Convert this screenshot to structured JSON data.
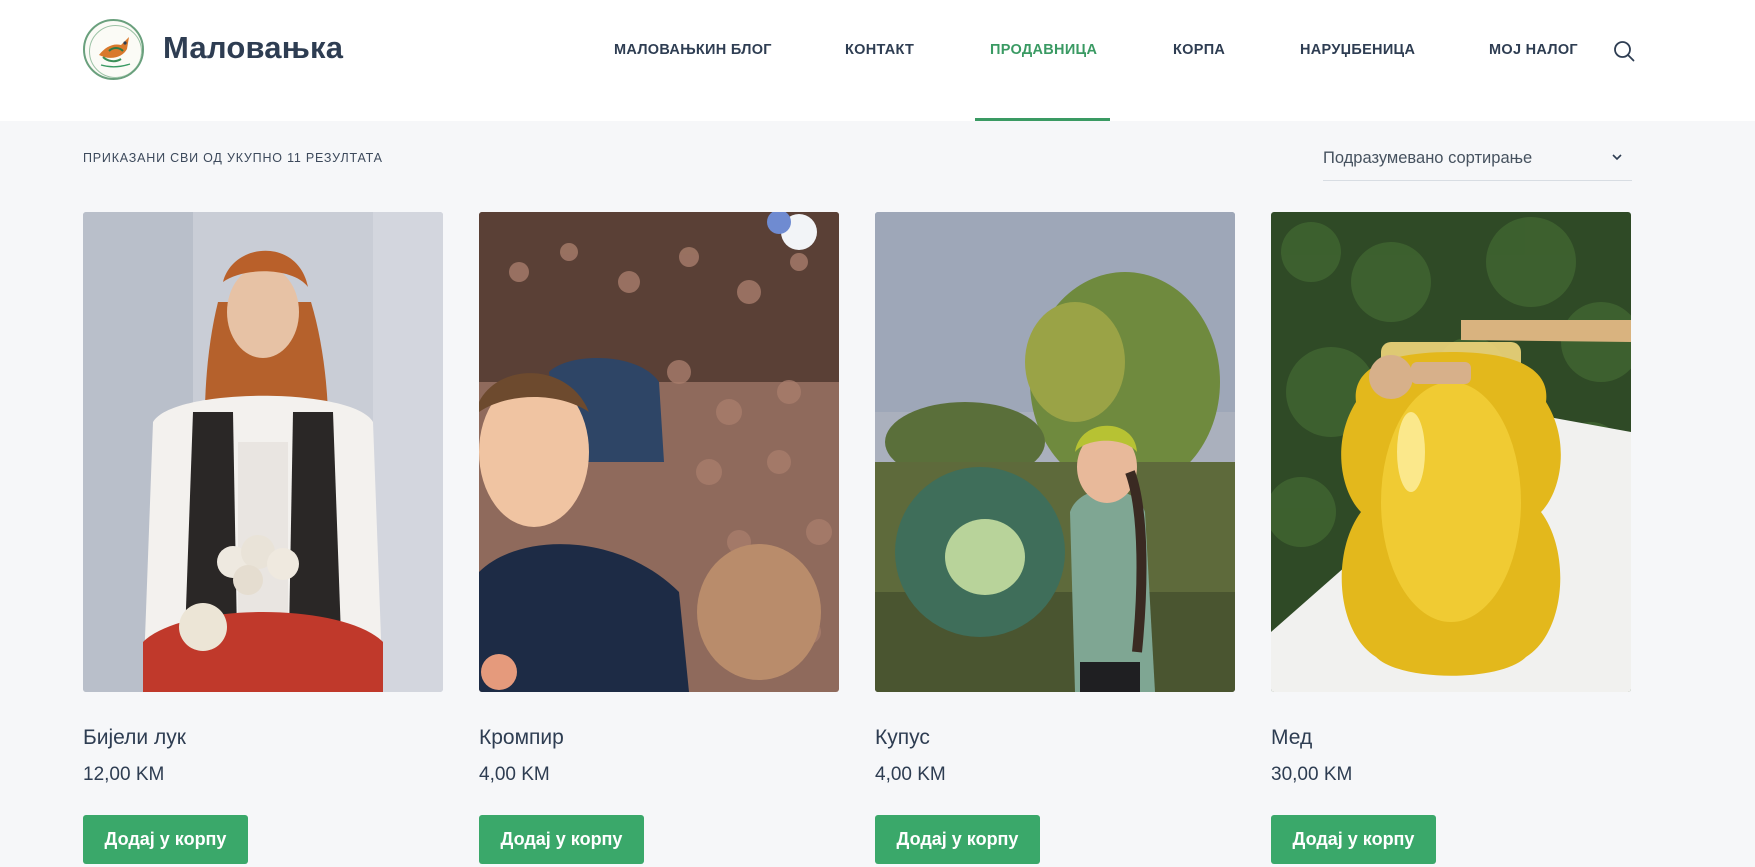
{
  "brand": {
    "name": "Маловањка",
    "logo_icon": "bird-logo-icon"
  },
  "nav": {
    "items": [
      {
        "label": "МАЛОВАЊКИН БЛОГ",
        "active": false
      },
      {
        "label": "КОНТАКТ",
        "active": false
      },
      {
        "label": "ПРОДАВНИЦА",
        "active": true
      },
      {
        "label": "КОРПА",
        "active": false
      },
      {
        "label": "НАРУЏБЕНИЦА",
        "active": false
      },
      {
        "label": "МОЈ НАЛОГ",
        "active": false
      }
    ],
    "search_icon": "search-icon"
  },
  "shop": {
    "result_count": "ПРИКАЗАНИ СВИ ОД УКУПНО 11 РЕЗУЛТАТА",
    "sort_label": "Подразумевано сортирање"
  },
  "products": [
    {
      "title": "Бијели лук",
      "price": "12,00 KM",
      "button": "Додај у корпу"
    },
    {
      "title": "Кромпир",
      "price": "4,00 KM",
      "button": "Додај у корпу"
    },
    {
      "title": "Купус",
      "price": "4,00 KM",
      "button": "Додај у корпу"
    },
    {
      "title": "Мед",
      "price": "30,00 KM",
      "button": "Додај у корпу"
    }
  ],
  "colors": {
    "accent": "#3aa86a",
    "active_nav": "#3a9a63",
    "text": "#2e3d52",
    "background": "#f6f7f9"
  }
}
